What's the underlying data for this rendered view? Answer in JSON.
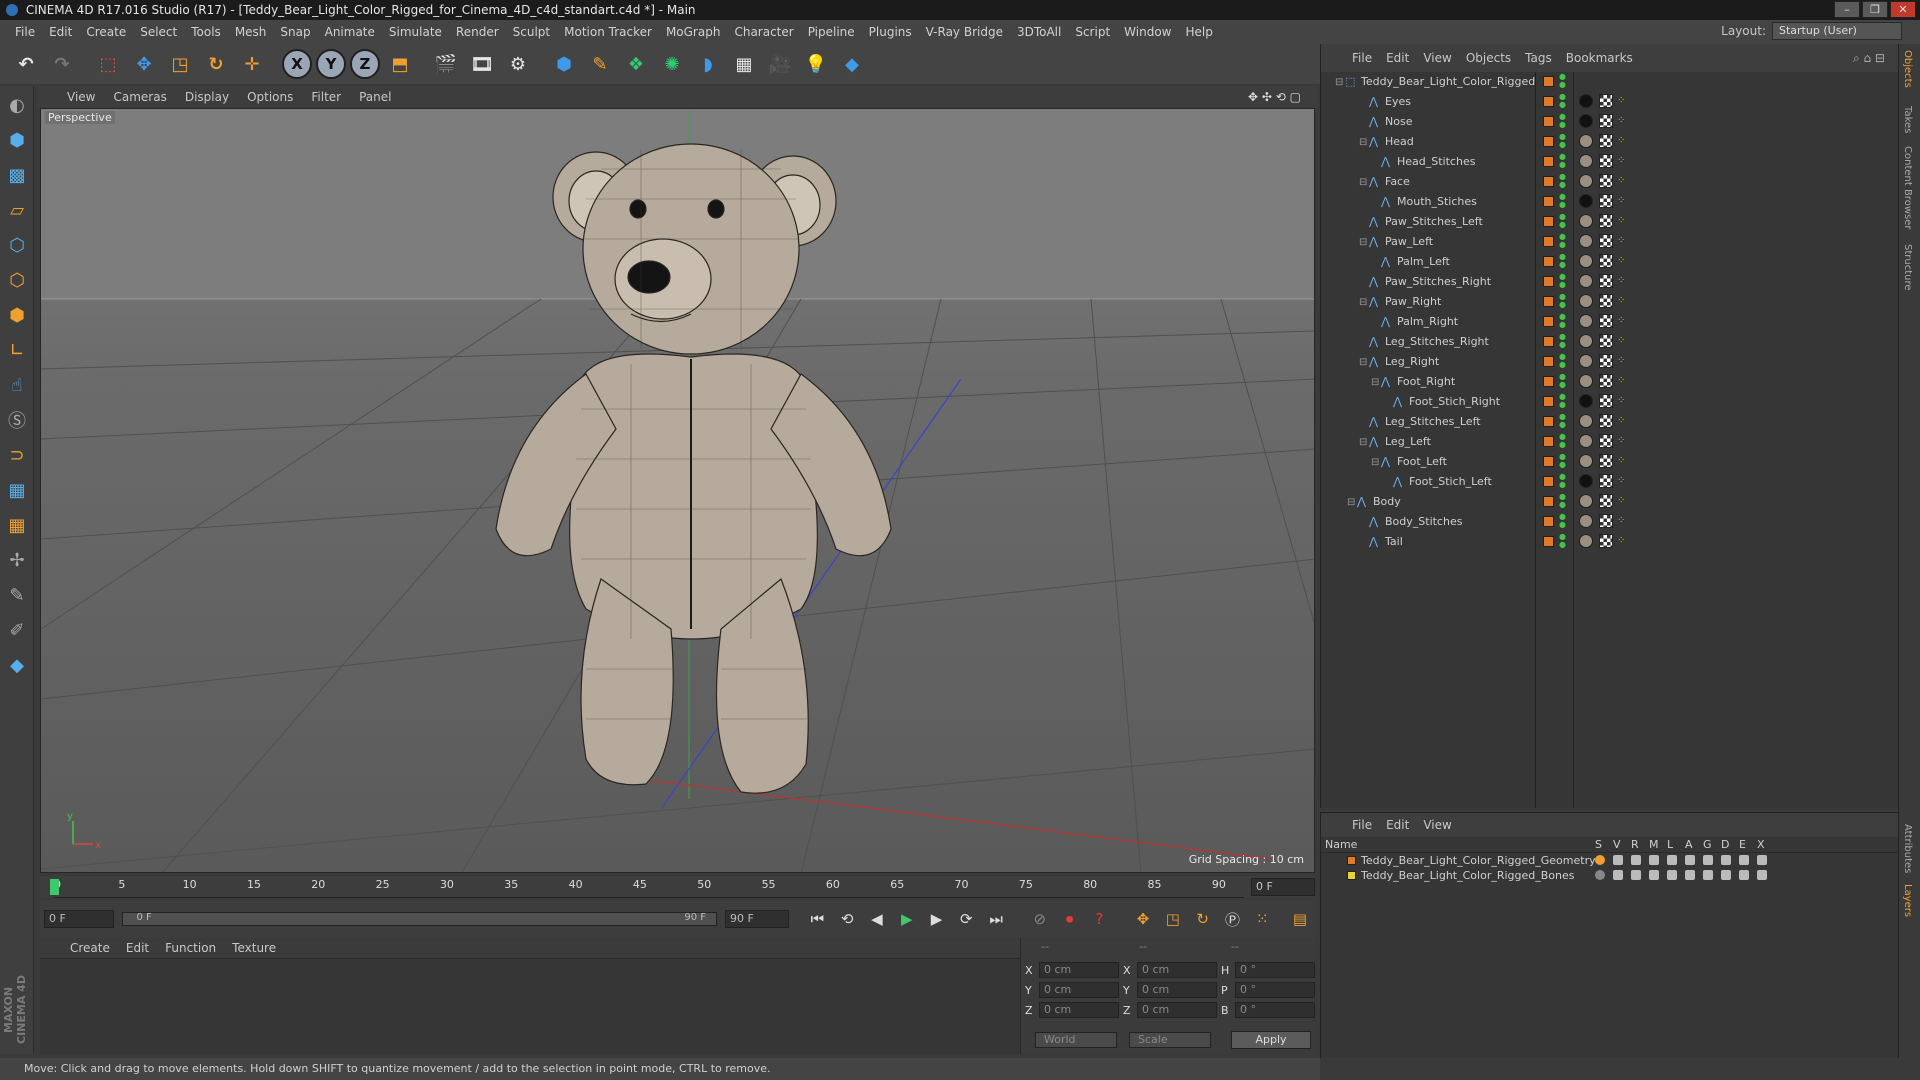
{
  "window": {
    "title": "CINEMA 4D R17.016 Studio (R17) - [Teddy_Bear_Light_Color_Rigged_for_Cinema_4D_c4d_standart.c4d *] - Main",
    "controls": [
      "–",
      "❐",
      "✕"
    ]
  },
  "menubar": {
    "items": [
      "File",
      "Edit",
      "Create",
      "Select",
      "Tools",
      "Mesh",
      "Snap",
      "Animate",
      "Simulate",
      "Render",
      "Sculpt",
      "Motion Tracker",
      "MoGraph",
      "Character",
      "Pipeline",
      "Plugins",
      "V-Ray Bridge",
      "3DToAll",
      "Script",
      "Window",
      "Help"
    ],
    "layout_label": "Layout:",
    "layout_value": "Startup (User)"
  },
  "toolbar": {
    "axis_x": "X",
    "axis_y": "Y",
    "axis_z": "Z"
  },
  "viewport": {
    "menu": [
      "View",
      "Cameras",
      "Display",
      "Options",
      "Filter",
      "Panel"
    ],
    "camera_label": "Perspective",
    "grid_spacing": "Grid Spacing : 10 cm",
    "axis_y_label": "y",
    "axis_x_label": "x"
  },
  "timeline": {
    "ticks": [
      "0",
      "5",
      "10",
      "15",
      "20",
      "25",
      "30",
      "35",
      "40",
      "45",
      "50",
      "55",
      "60",
      "65",
      "70",
      "75",
      "80",
      "85",
      "90"
    ],
    "current_frame_right": "0 F",
    "start_frame": "0 F",
    "scrub_start": "0 F",
    "scrub_end": "90 F",
    "end_frame": "90 F"
  },
  "material_manager": {
    "menu": [
      "Create",
      "Edit",
      "Function",
      "Texture"
    ]
  },
  "coordinates": {
    "header": [
      "--",
      "--",
      "--"
    ],
    "rows": [
      {
        "l1": "X",
        "v1": "0 cm",
        "l2": "X",
        "v2": "0 cm",
        "l3": "H",
        "v3": "0 °"
      },
      {
        "l1": "Y",
        "v1": "0 cm",
        "l2": "Y",
        "v2": "0 cm",
        "l3": "P",
        "v3": "0 °"
      },
      {
        "l1": "Z",
        "v1": "0 cm",
        "l2": "Z",
        "v2": "0 cm",
        "l3": "B",
        "v3": "0 °"
      }
    ],
    "space": "World",
    "mode": "Scale",
    "apply": "Apply"
  },
  "statusbar": {
    "text": "Move: Click and drag to move elements. Hold down SHIFT to quantize movement / add to the selection in point mode, CTRL to remove."
  },
  "object_manager": {
    "menu": [
      "File",
      "Edit",
      "View",
      "Objects",
      "Tags",
      "Bookmarks"
    ],
    "objects": [
      {
        "name": "Teddy_Bear_Light_Color_Rigged",
        "depth": 0,
        "expand": "⊟",
        "mat": "none"
      },
      {
        "name": "Eyes",
        "depth": 2,
        "expand": "",
        "mat": "#111111"
      },
      {
        "name": "Nose",
        "depth": 2,
        "expand": "",
        "mat": "#111111"
      },
      {
        "name": "Head",
        "depth": 2,
        "expand": "⊟",
        "mat": "#9a8f80"
      },
      {
        "name": "Head_Stitches",
        "depth": 3,
        "expand": "",
        "mat": "#9a8f80"
      },
      {
        "name": "Face",
        "depth": 2,
        "expand": "⊟",
        "mat": "#9a8f80"
      },
      {
        "name": "Mouth_Stiches",
        "depth": 3,
        "expand": "",
        "mat": "#111111"
      },
      {
        "name": "Paw_Stitches_Left",
        "depth": 2,
        "expand": "",
        "mat": "#9a8f80"
      },
      {
        "name": "Paw_Left",
        "depth": 2,
        "expand": "⊟",
        "mat": "#9a8f80"
      },
      {
        "name": "Palm_Left",
        "depth": 3,
        "expand": "",
        "mat": "#9a8f80"
      },
      {
        "name": "Paw_Stitches_Right",
        "depth": 2,
        "expand": "",
        "mat": "#9a8f80"
      },
      {
        "name": "Paw_Right",
        "depth": 2,
        "expand": "⊟",
        "mat": "#9a8f80"
      },
      {
        "name": "Palm_Right",
        "depth": 3,
        "expand": "",
        "mat": "#9a8f80"
      },
      {
        "name": "Leg_Stitches_Right",
        "depth": 2,
        "expand": "",
        "mat": "#9a8f80"
      },
      {
        "name": "Leg_Right",
        "depth": 2,
        "expand": "⊟",
        "mat": "#9a8f80"
      },
      {
        "name": "Foot_Right",
        "depth": 3,
        "expand": "⊟",
        "mat": "#9a8f80"
      },
      {
        "name": "Foot_Stich_Right",
        "depth": 4,
        "expand": "",
        "mat": "#111111"
      },
      {
        "name": "Leg_Stitches_Left",
        "depth": 2,
        "expand": "",
        "mat": "#9a8f80"
      },
      {
        "name": "Leg_Left",
        "depth": 2,
        "expand": "⊟",
        "mat": "#9a8f80"
      },
      {
        "name": "Foot_Left",
        "depth": 3,
        "expand": "⊟",
        "mat": "#9a8f80"
      },
      {
        "name": "Foot_Stich_Left",
        "depth": 4,
        "expand": "",
        "mat": "#111111"
      },
      {
        "name": "Body",
        "depth": 1,
        "expand": "⊟",
        "mat": "#9a8f80"
      },
      {
        "name": "Body_Stitches",
        "depth": 2,
        "expand": "",
        "mat": "#9a8f80"
      },
      {
        "name": "Tail",
        "depth": 2,
        "expand": "",
        "mat": "#9a8f80"
      }
    ]
  },
  "layer_manager": {
    "menu": [
      "File",
      "Edit",
      "View"
    ],
    "columns": [
      "Name",
      "S",
      "V",
      "R",
      "M",
      "L",
      "A",
      "G",
      "D",
      "E",
      "X"
    ],
    "layers": [
      {
        "name": "Teddy_Bear_Light_Color_Rigged_Geometry",
        "color": "#e07a2a"
      },
      {
        "name": "Teddy_Bear_Light_Color_Rigged_Bones",
        "color": "#e8d23a"
      }
    ]
  },
  "side_tabs": [
    "Objects",
    "Takes",
    "Content Browser",
    "Structure",
    "Attributes",
    "Layers"
  ],
  "branding": "MAXON CINEMA 4D"
}
